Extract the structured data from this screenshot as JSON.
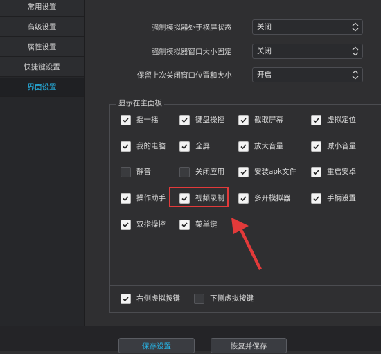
{
  "sidebar": {
    "items": [
      {
        "label": "常用设置"
      },
      {
        "label": "高级设置"
      },
      {
        "label": "属性设置"
      },
      {
        "label": "快捷键设置"
      },
      {
        "label": "界面设置",
        "active": true
      }
    ]
  },
  "settings": [
    {
      "label": "强制模拟器处于横屏状态",
      "value": "关闭"
    },
    {
      "label": "强制模拟器窗口大小固定",
      "value": "关闭"
    },
    {
      "label": "保留上次关闭窗口位置和大小",
      "value": "开启"
    }
  ],
  "main_panel": {
    "title": "显示在主面板",
    "items": [
      {
        "label": "摇一摇",
        "checked": true
      },
      {
        "label": "键盘操控",
        "checked": true
      },
      {
        "label": "截取屏幕",
        "checked": true
      },
      {
        "label": "虚拟定位",
        "checked": true
      },
      {
        "label": "我的电脑",
        "checked": true
      },
      {
        "label": "全屏",
        "checked": true
      },
      {
        "label": "放大音量",
        "checked": true
      },
      {
        "label": "减小音量",
        "checked": true
      },
      {
        "label": "静音",
        "checked": false
      },
      {
        "label": "关闭应用",
        "checked": false
      },
      {
        "label": "安装apk文件",
        "checked": true
      },
      {
        "label": "重启安卓",
        "checked": true
      },
      {
        "label": "操作助手",
        "checked": true
      },
      {
        "label": "视频录制",
        "checked": true
      },
      {
        "label": "多开模拟器",
        "checked": true
      },
      {
        "label": "手柄设置",
        "checked": true
      },
      {
        "label": "双指操控",
        "checked": true
      },
      {
        "label": "菜单键",
        "checked": true
      }
    ],
    "virtual_keys": [
      {
        "label": "右侧虚拟按键",
        "checked": true
      },
      {
        "label": "下侧虚拟按键",
        "checked": false
      }
    ]
  },
  "buttons": {
    "save": "保存设置",
    "restore": "恢复并保存"
  },
  "colors": {
    "accent": "#27b7ea",
    "annotation": "#e23a3a",
    "background": "#2f2f31"
  }
}
